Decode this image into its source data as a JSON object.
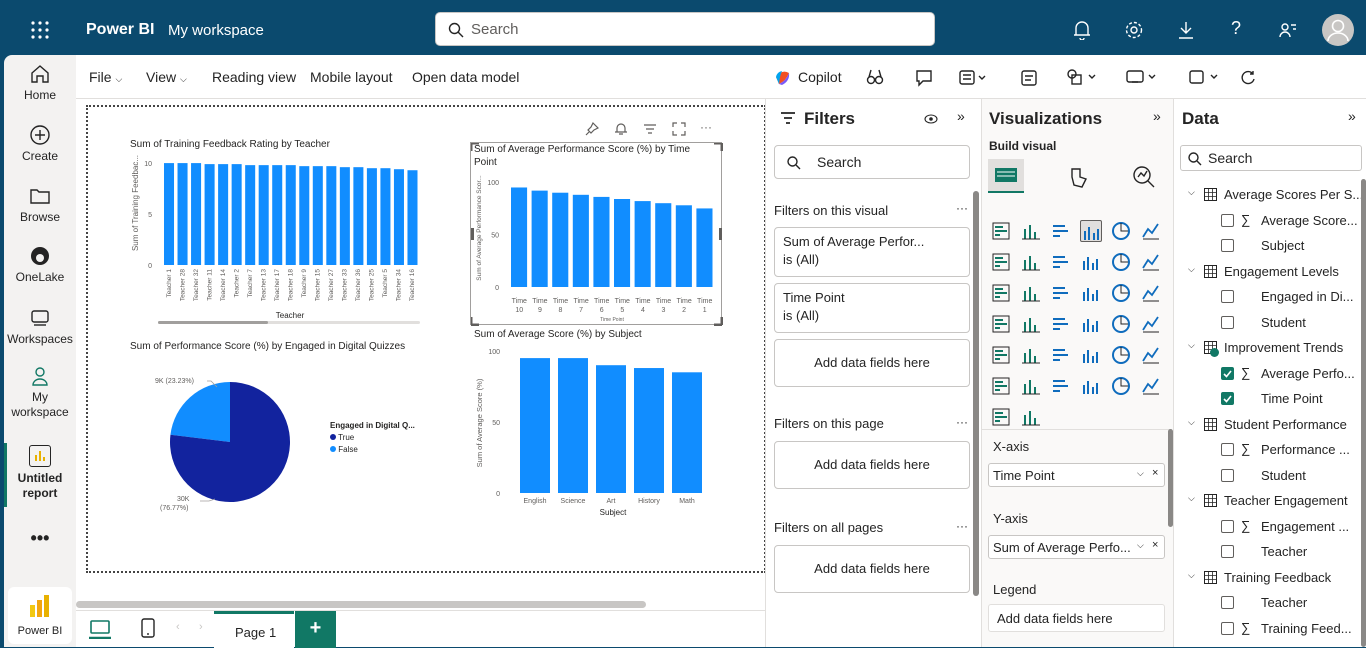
{
  "topbar": {
    "app_name": "Power BI",
    "workspace": "My workspace",
    "search_placeholder": "Search"
  },
  "rail": {
    "items": [
      {
        "label": "Home"
      },
      {
        "label": "Create"
      },
      {
        "label": "Browse"
      },
      {
        "label": "OneLake"
      },
      {
        "label": "Workspaces"
      },
      {
        "label": "My workspace"
      },
      {
        "label": "Untitled report"
      },
      {
        "label": "Power BI"
      }
    ]
  },
  "menu": {
    "file": "File",
    "view": "View",
    "reading_view": "Reading view",
    "mobile_layout": "Mobile layout",
    "open_data_model": "Open data model",
    "copilot": "Copilot"
  },
  "visuals": {
    "v1": {
      "title": "Sum of Training Feedback Rating by Teacher",
      "ylabel": "Sum of Training Feedbac...",
      "xlabel": "Teacher",
      "yticks": [
        "10",
        "5",
        "0"
      ],
      "categories": [
        "Teacher 1",
        "Teacher 28",
        "Teacher 32",
        "Teacher 11",
        "Teacher 14",
        "Teacher 2",
        "Teacher 7",
        "Teacher 13",
        "Teacher 17",
        "Teacher 18",
        "Teacher 9",
        "Teacher 15",
        "Teacher 27",
        "Teacher 33",
        "Teacher 36",
        "Teacher 25",
        "Teacher 5",
        "Teacher 34",
        "Teacher 16"
      ],
      "values": [
        10,
        10,
        10,
        9.9,
        9.9,
        9.9,
        9.8,
        9.8,
        9.8,
        9.8,
        9.7,
        9.7,
        9.7,
        9.6,
        9.6,
        9.5,
        9.5,
        9.4,
        9.3
      ],
      "ymax": 10.5
    },
    "v2": {
      "title": "Sum of Average Performance Score (%) by Time Point",
      "ylabel": "Sum of Average Performance Scor...",
      "xlabel": "Time Point",
      "yticks": [
        "100",
        "50",
        "0"
      ],
      "categories": [
        [
          "Time",
          "10"
        ],
        [
          "Time",
          "9"
        ],
        [
          "Time",
          "8"
        ],
        [
          "Time",
          "7"
        ],
        [
          "Time",
          "6"
        ],
        [
          "Time",
          "5"
        ],
        [
          "Time",
          "4"
        ],
        [
          "Time",
          "3"
        ],
        [
          "Time",
          "2"
        ],
        [
          "Time",
          "1"
        ]
      ],
      "values": [
        95,
        92,
        90,
        88,
        86,
        84,
        82,
        80,
        78,
        75
      ],
      "ymax": 105
    },
    "v3": {
      "title": "Sum of Performance Score (%) by Engaged in Digital Quizzes",
      "legend_title": "Engaged in Digital Q...",
      "slices": [
        {
          "name": "True",
          "value": 30,
          "label": "30K",
          "pct": "(76.77%)",
          "color": "#12239e"
        },
        {
          "name": "False",
          "value": 9,
          "label": "9K (23.23%)",
          "color": "#118dff"
        }
      ]
    },
    "v4": {
      "title": "Sum of Average Score (%) by Subject",
      "ylabel": "Sum of Average Score (%)",
      "xlabel": "Subject",
      "yticks": [
        "100",
        "50",
        "0"
      ],
      "categories": [
        "English",
        "Science",
        "Art",
        "History",
        "Math"
      ],
      "values": [
        95,
        95,
        90,
        88,
        85
      ],
      "ymax": 100
    }
  },
  "chart_data": [
    {
      "type": "bar",
      "title": "Sum of Training Feedback Rating by Teacher",
      "xlabel": "Teacher",
      "ylabel": "Sum of Training Feedbac...",
      "categories": [
        "Teacher 1",
        "Teacher 28",
        "Teacher 32",
        "Teacher 11",
        "Teacher 14",
        "Teacher 2",
        "Teacher 7",
        "Teacher 13",
        "Teacher 17",
        "Teacher 18",
        "Teacher 9",
        "Teacher 15",
        "Teacher 27",
        "Teacher 33",
        "Teacher 36",
        "Teacher 25",
        "Teacher 5",
        "Teacher 34",
        "Teacher 16"
      ],
      "values": [
        10,
        10,
        10,
        9.9,
        9.9,
        9.9,
        9.8,
        9.8,
        9.8,
        9.8,
        9.7,
        9.7,
        9.7,
        9.6,
        9.6,
        9.5,
        9.5,
        9.4,
        9.3
      ]
    },
    {
      "type": "bar",
      "title": "Sum of Average Performance Score (%) by Time Point",
      "xlabel": "Time Point",
      "categories": [
        "Time 10",
        "Time 9",
        "Time 8",
        "Time 7",
        "Time 6",
        "Time 5",
        "Time 4",
        "Time 3",
        "Time 2",
        "Time 1"
      ],
      "values": [
        95,
        92,
        90,
        88,
        86,
        84,
        82,
        80,
        78,
        75
      ]
    },
    {
      "type": "pie",
      "title": "Sum of Performance Score (%) by Engaged in Digital Quizzes",
      "categories": [
        "True",
        "False"
      ],
      "values": [
        30000,
        9000
      ]
    },
    {
      "type": "bar",
      "title": "Sum of Average Score (%) by Subject",
      "xlabel": "Subject",
      "ylabel": "Sum of Average Score (%)",
      "categories": [
        "English",
        "Science",
        "Art",
        "History",
        "Math"
      ],
      "values": [
        95,
        95,
        90,
        88,
        85
      ]
    }
  ],
  "filters": {
    "title": "Filters",
    "search": "Search",
    "on_visual": "Filters on this visual",
    "card1_title": "Sum of Average Perfor...",
    "card1_value": "is (All)",
    "card2_title": "Time Point",
    "card2_value": "is (All)",
    "add_fields": "Add data fields here",
    "on_page": "Filters on this page",
    "on_all": "Filters on all pages"
  },
  "viz": {
    "title": "Visualizations",
    "build": "Build visual",
    "xaxis": "X-axis",
    "xaxis_field": "Time Point",
    "yaxis": "Y-axis",
    "yaxis_field": "Sum of Average Perfo...",
    "legend": "Legend",
    "add_fields": "Add data fields here"
  },
  "data": {
    "title": "Data",
    "search": "Search",
    "tables": [
      {
        "name": "Average Scores Per S...",
        "fields": [
          {
            "name": "Average Score...",
            "sigma": true,
            "checked": false
          },
          {
            "name": "Subject",
            "sigma": false,
            "checked": false
          }
        ]
      },
      {
        "name": "Engagement Levels",
        "fields": [
          {
            "name": "Engaged in Di...",
            "sigma": false,
            "checked": false
          },
          {
            "name": "Student",
            "sigma": false,
            "checked": false
          }
        ]
      },
      {
        "name": "Improvement Trends",
        "fields": [
          {
            "name": "Average Perfo...",
            "sigma": true,
            "checked": true
          },
          {
            "name": "Time Point",
            "sigma": false,
            "checked": true
          }
        ]
      },
      {
        "name": "Student Performance",
        "fields": [
          {
            "name": "Performance ...",
            "sigma": true,
            "checked": false
          },
          {
            "name": "Student",
            "sigma": false,
            "checked": false
          }
        ]
      },
      {
        "name": "Teacher Engagement",
        "fields": [
          {
            "name": "Engagement ...",
            "sigma": true,
            "checked": false
          },
          {
            "name": "Teacher",
            "sigma": false,
            "checked": false
          }
        ]
      },
      {
        "name": "Training Feedback",
        "fields": [
          {
            "name": "Teacher",
            "sigma": false,
            "checked": false
          },
          {
            "name": "Training Feed...",
            "sigma": true,
            "checked": false
          }
        ]
      }
    ]
  },
  "bottom": {
    "page1": "Page 1",
    "add": "+"
  },
  "colors": {
    "bar": "#118dff",
    "dark": "#12239e",
    "brand": "#117865"
  }
}
